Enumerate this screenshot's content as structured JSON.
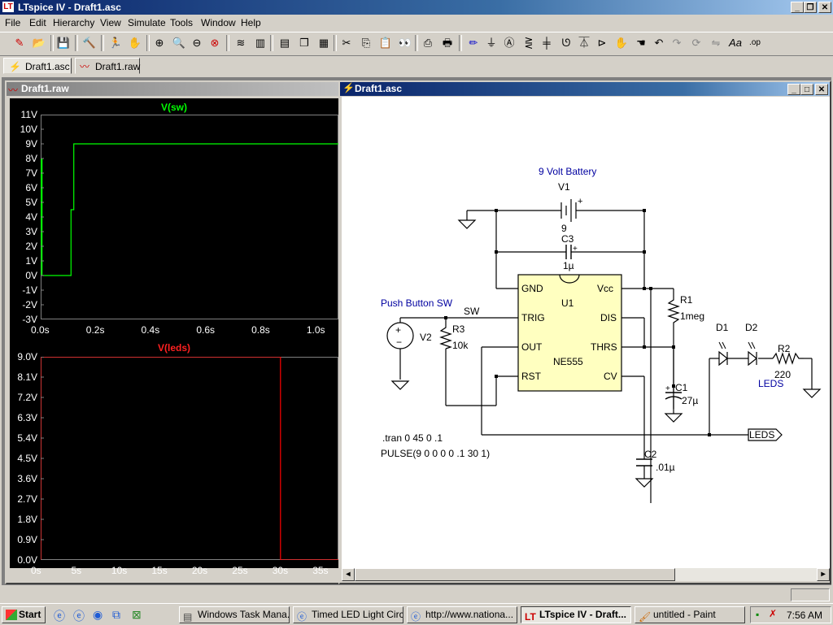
{
  "window": {
    "title": "LTspice IV - Draft1.asc",
    "app_icon": "LT"
  },
  "menu": [
    "File",
    "Edit",
    "Hierarchy",
    "View",
    "Simulate",
    "Tools",
    "Window",
    "Help"
  ],
  "tabs": [
    {
      "label": "Draft1.asc",
      "icon": "schematic-icon",
      "active": true
    },
    {
      "label": "Draft1.raw",
      "icon": "waveform-icon",
      "active": false
    }
  ],
  "waveform_window": {
    "title": "Draft1.raw",
    "top_plot": {
      "trace_label": "V(sw)",
      "trace_color": "#00ff00",
      "y_ticks": [
        "11V",
        "10V",
        "9V",
        "8V",
        "7V",
        "6V",
        "5V",
        "4V",
        "3V",
        "2V",
        "1V",
        "0V",
        "-1V",
        "-2V",
        "-3V"
      ],
      "x_ticks": [
        "0.0s",
        "0.2s",
        "0.4s",
        "0.6s",
        "0.8s",
        "1.0s"
      ]
    },
    "bottom_plot": {
      "trace_label": "V(leds)",
      "trace_color": "#ff0000",
      "y_ticks": [
        "9.0V",
        "8.1V",
        "7.2V",
        "6.3V",
        "5.4V",
        "4.5V",
        "3.6V",
        "2.7V",
        "1.8V",
        "0.9V",
        "0.0V"
      ],
      "x_ticks": [
        "0s",
        "5s",
        "10s",
        "15s",
        "20s",
        "25s",
        "30s",
        "35s"
      ]
    }
  },
  "chart_data": [
    {
      "type": "line",
      "title": "V(sw)",
      "ylim": [
        -3,
        11
      ],
      "xlim": [
        0,
        1.08
      ],
      "series": [
        {
          "name": "V(sw)",
          "x": [
            0,
            0.002,
            0.003,
            0.005,
            0.005,
            0.11,
            0.11,
            0.12,
            0.12,
            1.08
          ],
          "y": [
            0,
            8,
            4,
            8,
            0,
            0,
            4.5,
            4.5,
            9,
            9
          ]
        }
      ]
    },
    {
      "type": "line",
      "title": "V(leds)",
      "ylim": [
        0,
        9
      ],
      "xlim": [
        0,
        37
      ],
      "series": [
        {
          "name": "V(leds)",
          "x": [
            0,
            0,
            29.8,
            29.8,
            37
          ],
          "y": [
            0,
            9,
            9,
            0,
            0
          ]
        }
      ]
    }
  ],
  "schematic_window": {
    "title": "Draft1.asc",
    "labels": {
      "battery_title": "9 Volt Battery",
      "v1": "V1",
      "v1_val": "9",
      "c3": "C3",
      "c3_val": "1µ",
      "push_button": "Push Button SW",
      "sw": "SW",
      "v2": "V2",
      "r3": "R3",
      "r3_val": "10k",
      "u1": "U1",
      "ne555": "NE555",
      "gnd": "GND",
      "vcc": "Vcc",
      "trig": "TRIG",
      "dis": "DIS",
      "out": "OUT",
      "thrs": "THRS",
      "rst": "RST",
      "cv": "CV",
      "r1": "R1",
      "r1_val": "1meg",
      "c1": "C1",
      "c1_val": "27µ",
      "d1": "D1",
      "d2": "D2",
      "r2": "R2",
      "r2_val": "220",
      "leds_label": "LEDS",
      "leds_flag": "LEDS",
      "c2": "C2",
      "c2_val": ".01µ",
      "directive1": ".tran 0 45 0 .1",
      "directive2": "PULSE(9 0 0 0 0 .1 30 1)"
    }
  },
  "taskbar": {
    "start": "Start",
    "tasks": [
      "Windows Task Mana...",
      "Timed LED Light Circ...",
      "http://www.nationa...",
      "LTspice IV - Draft...",
      "untitled - Paint"
    ],
    "clock": "7:56 AM"
  }
}
